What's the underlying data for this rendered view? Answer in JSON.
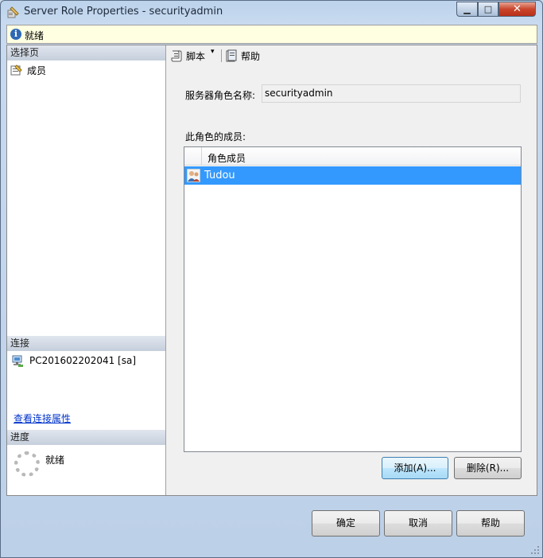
{
  "window": {
    "title": "Server Role Properties - securityadmin",
    "controls": {
      "minimize_icon": "minimize-icon",
      "maximize_icon": "maximize-icon",
      "close_icon": "close-icon"
    }
  },
  "infobar": {
    "icon": "info-icon",
    "text": "就绪"
  },
  "left": {
    "select_page_header": "选择页",
    "pages": [
      {
        "label": "成员",
        "icon": "page-properties-icon"
      }
    ],
    "connection_header": "连接",
    "connection": {
      "label": "PC201602202041 [sa]",
      "icon": "server-connection-icon"
    },
    "view_connection_link": "查看连接属性",
    "progress_header": "进度",
    "progress_status": "就绪"
  },
  "toolbar": {
    "script_label": "脚本",
    "script_caret": "▾",
    "help_label": "帮助"
  },
  "form": {
    "role_name_label": "服务器角色名称:",
    "role_name_value": "securityadmin",
    "members_label": "此角色的成员:",
    "grid": {
      "column_header": "角色成员",
      "rows": [
        {
          "name": "Tudou",
          "icon": "user-icon",
          "selected": true
        }
      ]
    },
    "add_button": "添加(A)...",
    "remove_button": "删除(R)..."
  },
  "footer": {
    "ok_button": "确定",
    "cancel_button": "取消",
    "help_button": "帮助"
  },
  "colors": {
    "selection": "#3399ff",
    "info_background": "#ffffe1",
    "link": "#0033cc",
    "section_header": "#c5cfdc"
  }
}
